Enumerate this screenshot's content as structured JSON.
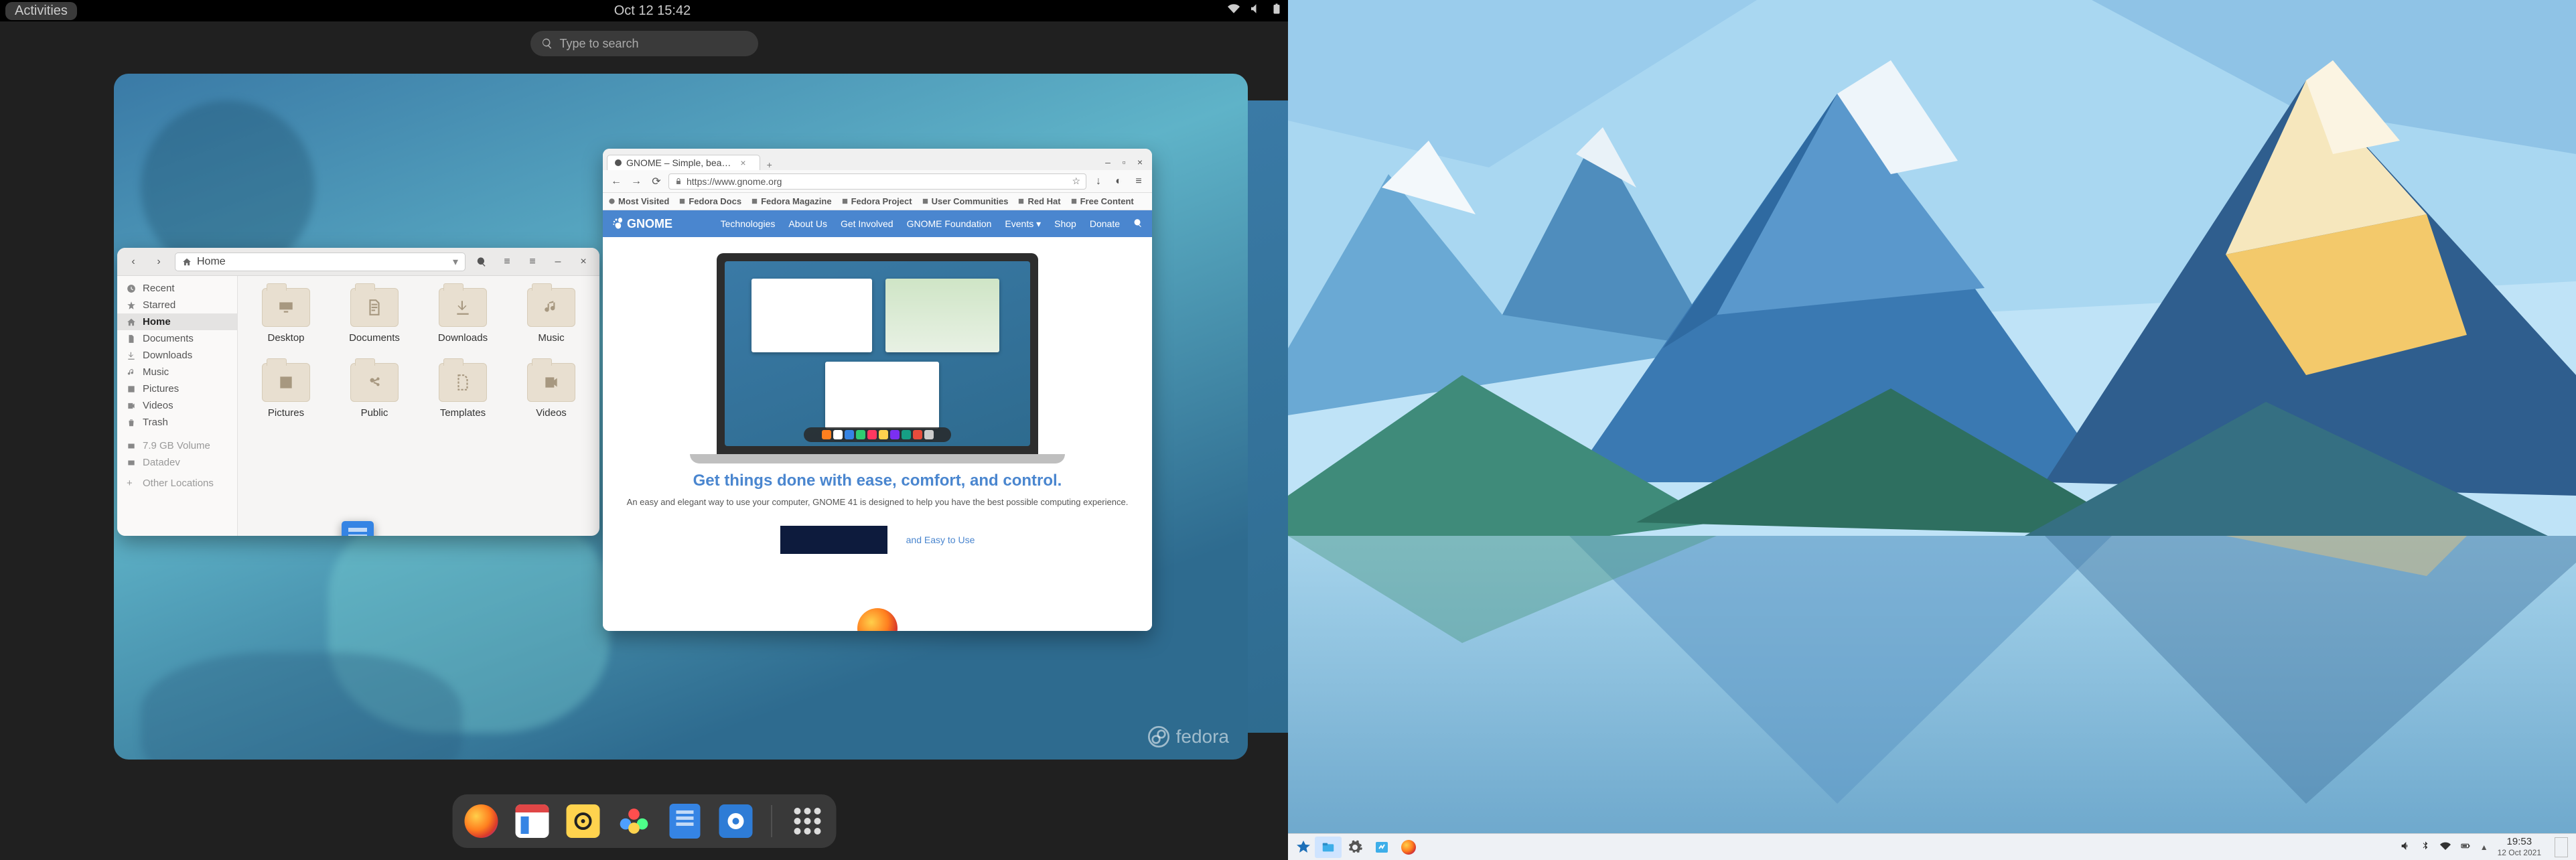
{
  "gnome": {
    "topbar": {
      "activities": "Activities",
      "clock": "Oct 12  15:42"
    },
    "search": {
      "placeholder": "Type to search"
    },
    "watermark": "fedora",
    "files": {
      "path_label": "Home",
      "sidebar": {
        "recent": "Recent",
        "starred": "Starred",
        "home": "Home",
        "documents": "Documents",
        "downloads": "Downloads",
        "music": "Music",
        "pictures": "Pictures",
        "videos": "Videos",
        "trash": "Trash",
        "volume": "7.9 GB Volume",
        "datadev": "Datadev",
        "other": "Other Locations"
      },
      "grid": {
        "desktop": "Desktop",
        "documents": "Documents",
        "downloads": "Downloads",
        "music": "Music",
        "pictures": "Pictures",
        "public": "Public",
        "templates": "Templates",
        "videos": "Videos"
      }
    },
    "firefox": {
      "tab_title": "GNOME – Simple, bea…",
      "url": "https://www.gnome.org",
      "bookmarks": {
        "most_visited": "Most Visited",
        "fedora_docs": "Fedora Docs",
        "fedora_magazine": "Fedora Magazine",
        "fedora_project": "Fedora Project",
        "user_communities": "User Communities",
        "red_hat": "Red Hat",
        "free_content": "Free Content"
      },
      "nav": {
        "brand": "GNOME",
        "technologies": "Technologies",
        "about": "About Us",
        "involved": "Get Involved",
        "foundation": "GNOME Foundation",
        "events": "Events",
        "shop": "Shop",
        "donate": "Donate"
      },
      "headline": "Get things done with ease, comfort, and control.",
      "subline": "An easy and elegant way to use your computer, GNOME 41 is designed to help you have the best possible computing experience.",
      "easy_link": "and Easy to Use"
    },
    "dash": {
      "firefox": "Firefox",
      "calendar": "Calendar",
      "rhythmbox": "Rhythmbox",
      "photos": "Photos",
      "files": "Files",
      "software": "Software",
      "apps": "Show Apps"
    }
  },
  "kde": {
    "clock_time": "19:53",
    "clock_date": "12 Oct 2021"
  }
}
